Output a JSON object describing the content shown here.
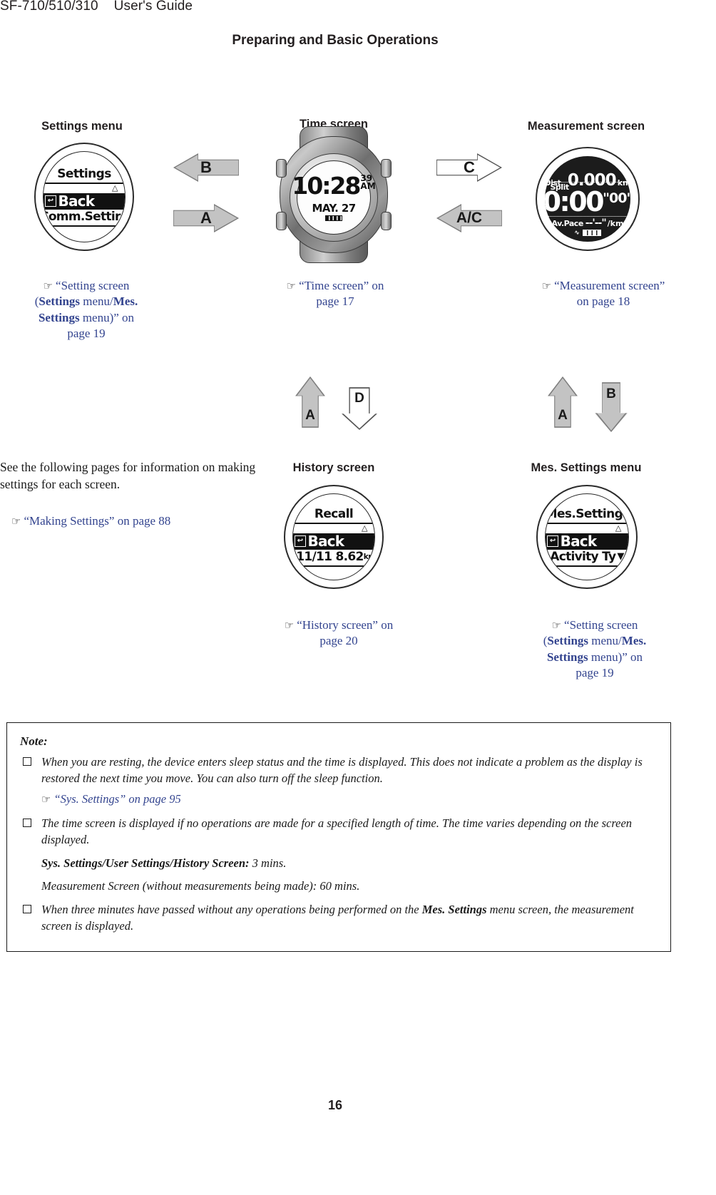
{
  "header": {
    "model": "SF-710/510/310",
    "guide": "User's Guide",
    "chapter": "Preparing and Basic Operations"
  },
  "screens": {
    "settings_menu": {
      "title": "Settings menu",
      "lcd_title": "Settings",
      "row_selected": "Back",
      "row_next": "Comm.Settir",
      "back_icon": "back-arrow-icon"
    },
    "time_screen": {
      "title": "Time screen",
      "time": "10:28",
      "seconds": "39",
      "meridiem": "AM",
      "date": "MAY. 27"
    },
    "measurement_screen": {
      "title": "Measurement screen",
      "dist_label": "Dist.",
      "dist_value": "0.000",
      "dist_unit": "km",
      "split_label": "Split",
      "split_time": "0:00",
      "split_seconds": "\"00\"",
      "avpace_label": "Av.Pace",
      "avpace_value": "--'--\"",
      "avpace_unit": "/km"
    },
    "history_screen": {
      "title": "History screen",
      "lcd_title": "Recall",
      "row_selected": "Back",
      "row_next": "11/11  8.62",
      "row_next_unit": "km"
    },
    "mes_settings_menu": {
      "title": "Mes. Settings menu",
      "lcd_title": "Mes.Settings",
      "row_selected": "Back",
      "row_next": "Activity Ty"
    }
  },
  "arrows": {
    "b_left": "B",
    "a_right": "A",
    "c_right": "C",
    "ac_left": "A/C",
    "a_up_mid": "A",
    "d_down_mid": "D",
    "a_up_right": "A",
    "b_down_right": "B"
  },
  "captions": {
    "settings_link": {
      "l1": "“Setting screen",
      "l2_pre": "(",
      "l2_b1": "Settings",
      "l2_mid": " menu/",
      "l2_b2": "Mes.",
      "l3_b": "Settings",
      "l3_post": " menu)” on",
      "l4": "page 19"
    },
    "time_link": {
      "l1": "“Time screen” on",
      "l2": "page 17"
    },
    "measurement_link": {
      "l1": "“Measurement screen”",
      "l2": "on page 18"
    },
    "history_link": {
      "l1": "“History screen” on",
      "l2": "page 20"
    },
    "mes_settings_link": {
      "l1": "“Setting screen",
      "l2_pre": "(",
      "l2_b1": "Settings",
      "l2_mid": " menu/",
      "l2_b2": "Mes.",
      "l3_b": "Settings",
      "l3_post": " menu)” on",
      "l4": "page 19"
    }
  },
  "left_text": {
    "paragraph": "See the following pages for information on making settings for each screen.",
    "link": "“Making Settings” on page 88"
  },
  "note": {
    "heading": "Note:",
    "item1": "When you are resting, the device enters sleep status and the time is displayed. This does not indicate a problem as the display is restored the next time you move. You can also turn off the sleep function.",
    "item1_link": "“Sys. Settings” on page 95",
    "item2": "The time screen is displayed if no operations are made for a specified length of time. The time varies depending on the screen displayed.",
    "item2_sub1_bold": "Sys. Settings/User Settings/History Screen:",
    "item2_sub1_rest": " 3 mins.",
    "item2_sub2": "Measurement Screen (without measurements being made): 60 mins.",
    "item3_pre": "When three minutes have passed without any operations being performed on the ",
    "item3_bold": "Mes. Settings",
    "item3_post": " menu screen, the measurement screen is displayed."
  },
  "footer": {
    "page_number": "16"
  },
  "icons": {
    "hand_pointer": "☞",
    "caret_up": "△",
    "caret_down": "▼",
    "back_glyph": "↰",
    "runner": "⮟"
  },
  "colors": {
    "link": "#33448f",
    "arrow_fill": "#c3c3c3",
    "text": "#1a1a1a"
  }
}
